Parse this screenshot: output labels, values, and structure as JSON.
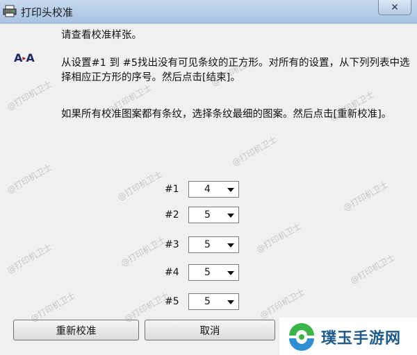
{
  "window": {
    "title": "打印头校准",
    "close_label": "✕"
  },
  "icons": {
    "app": "printer-icon",
    "aa": "alignment-aa-icon",
    "close": "close-icon"
  },
  "aa_icon": {
    "left": "A",
    "arrow": "▸",
    "right": "A"
  },
  "instructions": {
    "line1": "请查看校准样张。",
    "line2": "从设置#1 到 #5找出没有可见条纹的正方形。对所有的设置，从下列列表中选择相应正方形的序号。然后点击[结束]。",
    "line3": "如果所有校准图案都有条纹，选择条纹最细的图案。然后点击[重新校准]。"
  },
  "settings": [
    {
      "label": "#1",
      "value": "4"
    },
    {
      "label": "#2",
      "value": "5"
    },
    {
      "label": "#3",
      "value": "5"
    },
    {
      "label": "#4",
      "value": "5"
    },
    {
      "label": "#5",
      "value": "5"
    }
  ],
  "buttons": {
    "recalibrate": "重新校准",
    "cancel": "取消"
  },
  "watermark": "@打印机卫士",
  "brand": {
    "name": "璞玉手游网"
  },
  "colors": {
    "titlebar": "#b9cfea",
    "dialog_bg": "#f0f0f0",
    "brand_text": "#1b5a8c",
    "brand_green": "#3bb54a"
  }
}
